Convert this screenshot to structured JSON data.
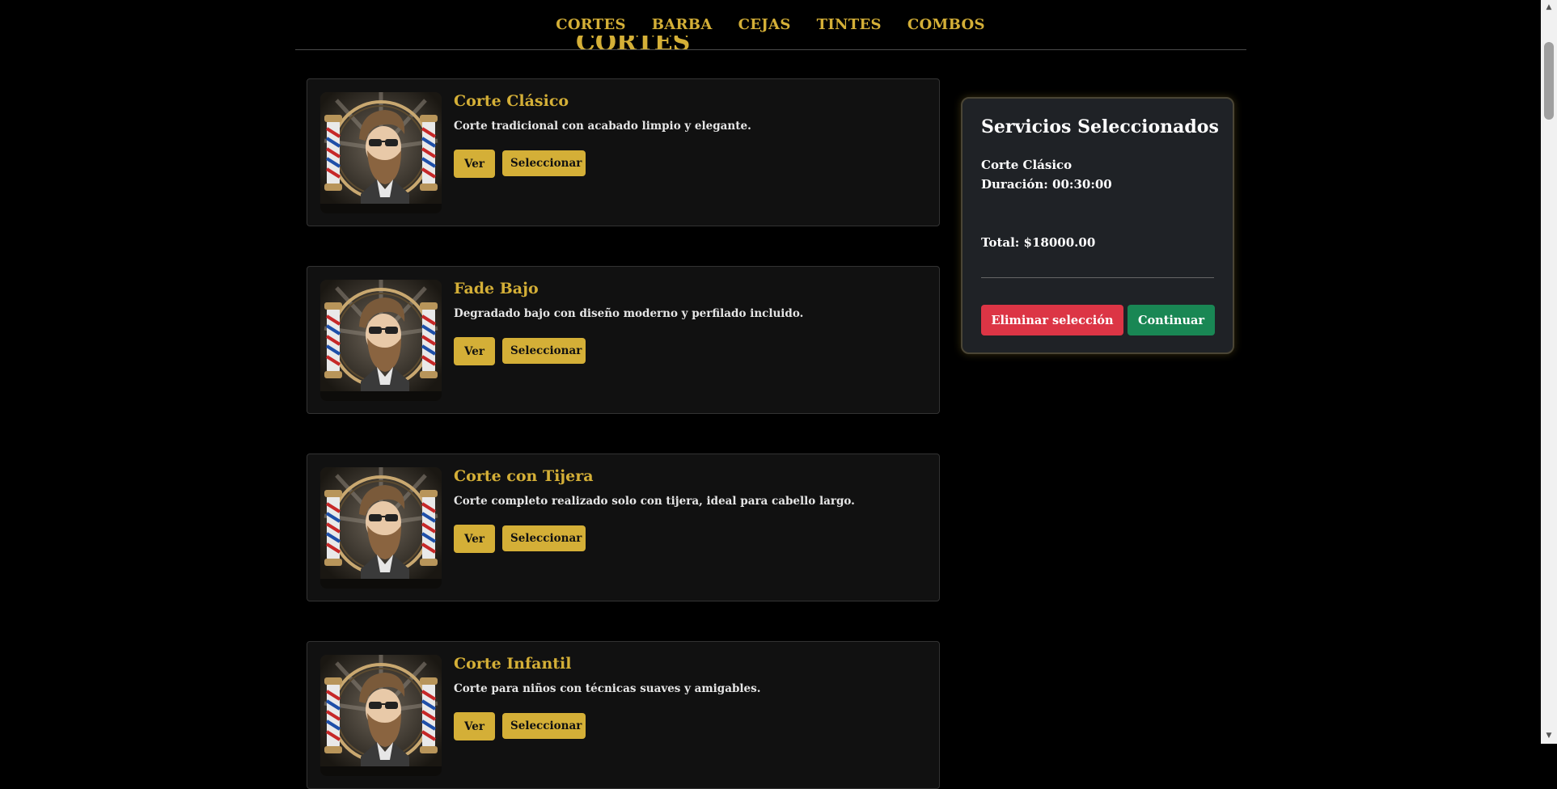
{
  "nav": {
    "items": [
      {
        "label": "CORTES"
      },
      {
        "label": "BARBA"
      },
      {
        "label": "CEJAS"
      },
      {
        "label": "TINTES"
      },
      {
        "label": "COMBOS"
      }
    ]
  },
  "section": {
    "title": "CORTES"
  },
  "services": [
    {
      "title": "Corte Clásico",
      "description": "Corte tradicional con acabado limpio y elegante.",
      "view_label": "Ver",
      "select_label": "Seleccionar",
      "image_icon": "barber-logo-icon"
    },
    {
      "title": "Fade Bajo",
      "description": "Degradado bajo con diseño moderno y perfilado incluido.",
      "view_label": "Ver",
      "select_label": "Seleccionar",
      "image_icon": "barber-logo-icon"
    },
    {
      "title": "Corte con Tijera",
      "description": "Corte completo realizado solo con tijera, ideal para cabello largo.",
      "view_label": "Ver",
      "select_label": "Seleccionar",
      "image_icon": "barber-logo-icon"
    },
    {
      "title": "Corte Infantil",
      "description": "Corte para niños con técnicas suaves y amigables.",
      "view_label": "Ver",
      "select_label": "Seleccionar",
      "image_icon": "barber-logo-icon"
    }
  ],
  "summary": {
    "title": "Servicios Seleccionados",
    "selected_service": "Corte Clásico",
    "duration": "Duración: 00:30:00",
    "total": "Total: $18000.00",
    "clear_label": "Eliminar selección",
    "continue_label": "Continuar"
  },
  "colors": {
    "accent": "#d4af37",
    "background": "#000000",
    "card": "#111111",
    "danger": "#dc3545",
    "success": "#198754"
  }
}
